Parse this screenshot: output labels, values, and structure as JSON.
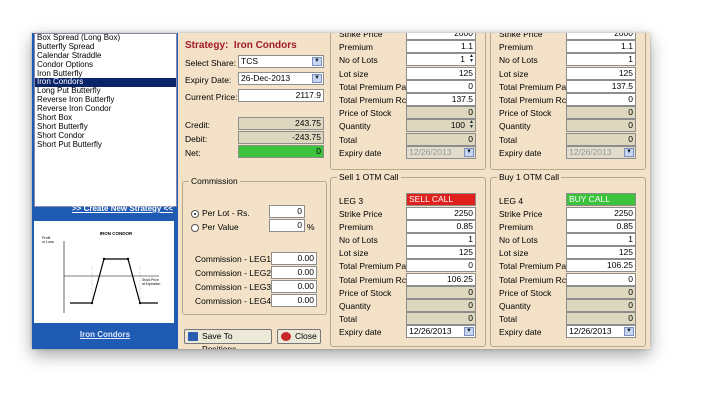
{
  "strategies": [
    "Box Spread (Long Box)",
    "Butterfly Spread",
    "Calendar Straddle",
    "Condor Options",
    "Iron Butterfly",
    "Iron Condors",
    "Long Put Butterfly",
    "Reverse Iron Butterfly",
    "Reverse Iron Condor",
    "Short Box",
    "Short Butterfly",
    "Short Condor",
    "Short Put Butterfly"
  ],
  "selected_index": 5,
  "create_link": ">> Create New Strategy <<",
  "thumbnail": {
    "title": "IRON CONDOR",
    "caption": "Iron Condors",
    "xlabel": "Stock Price at Expiration",
    "ylabel": "Profit or Loss"
  },
  "strategy": {
    "label": "Strategy:",
    "name": "Iron Condors"
  },
  "share": {
    "label": "Select Share:",
    "value": "TCS"
  },
  "expiry": {
    "label": "Expiry Date:",
    "value": "26-Dec-2013"
  },
  "current_price": {
    "label": "Current Price:",
    "value": "2117.9"
  },
  "credit": {
    "label": "Credit:",
    "value": "243.75"
  },
  "debit": {
    "label": "Debit:",
    "value": "-243.75"
  },
  "net": {
    "label": "Net:",
    "value": "0"
  },
  "commission": {
    "title": "Commission",
    "per_lot_label": "Per Lot - Rs.",
    "per_lot_value": "0",
    "per_value_label": "Per Value",
    "per_value_value": "0",
    "percent": "%",
    "legs": [
      {
        "label": "Commission - LEG1 :",
        "value": "0.00"
      },
      {
        "label": "Commission - LEG2 :",
        "value": "0.00"
      },
      {
        "label": "Commission - LEG3 :",
        "value": "0.00"
      },
      {
        "label": "Commission - LEG4 :",
        "value": "0.00"
      }
    ]
  },
  "buttons": {
    "save": "Save To Positions",
    "close": "Close"
  },
  "top_legs": [
    {
      "strike": "2000",
      "premium": "1.1",
      "lots": "1",
      "lot_size": "125",
      "tpp": "0",
      "tpr": "137.5",
      "price_stock": "0",
      "quantity": "100",
      "total": "0",
      "expiry": "12/26/2013"
    },
    {
      "strike": "2000",
      "premium": "1.1",
      "lots": "1",
      "lot_size": "125",
      "tpp": "137.5",
      "tpr": "0",
      "price_stock": "0",
      "quantity": "0",
      "total": "0",
      "expiry": "12/26/2013"
    }
  ],
  "bottom_legs": [
    {
      "group": "Sell 1 OTM Call",
      "leg": "LEG 3",
      "action": "SELL CALL",
      "strike": "2250",
      "premium": "0.85",
      "lots": "1",
      "lot_size": "125",
      "tpp": "0",
      "tpr": "106.25",
      "price_stock": "0",
      "quantity": "0",
      "total": "0",
      "expiry": "12/26/2013"
    },
    {
      "group": "Buy 1 OTM Call",
      "leg": "LEG 4",
      "action": "BUY CALL",
      "strike": "2250",
      "premium": "0.85",
      "lots": "1",
      "lot_size": "125",
      "tpp": "106.25",
      "tpr": "0",
      "price_stock": "0",
      "quantity": "0",
      "total": "0",
      "expiry": "12/26/2013"
    }
  ],
  "field_labels": {
    "strike": "Strike Price",
    "premium": "Premium",
    "lots": "No of Lots",
    "lot_size": "Lot size",
    "tpp": "Total Premium Paid",
    "tpr": "Total Premium Rcvd.",
    "price_stock": "Price of Stock",
    "quantity": "Quantity",
    "total": "Total",
    "expiry": "Expiry date"
  },
  "colors": {
    "sidebar": "#1f5bb3",
    "panel": "#f3e2c7",
    "title": "#a0192b",
    "net_green": "#3cc33c",
    "sell": "#e0201c",
    "buy": "#3cc33c"
  }
}
